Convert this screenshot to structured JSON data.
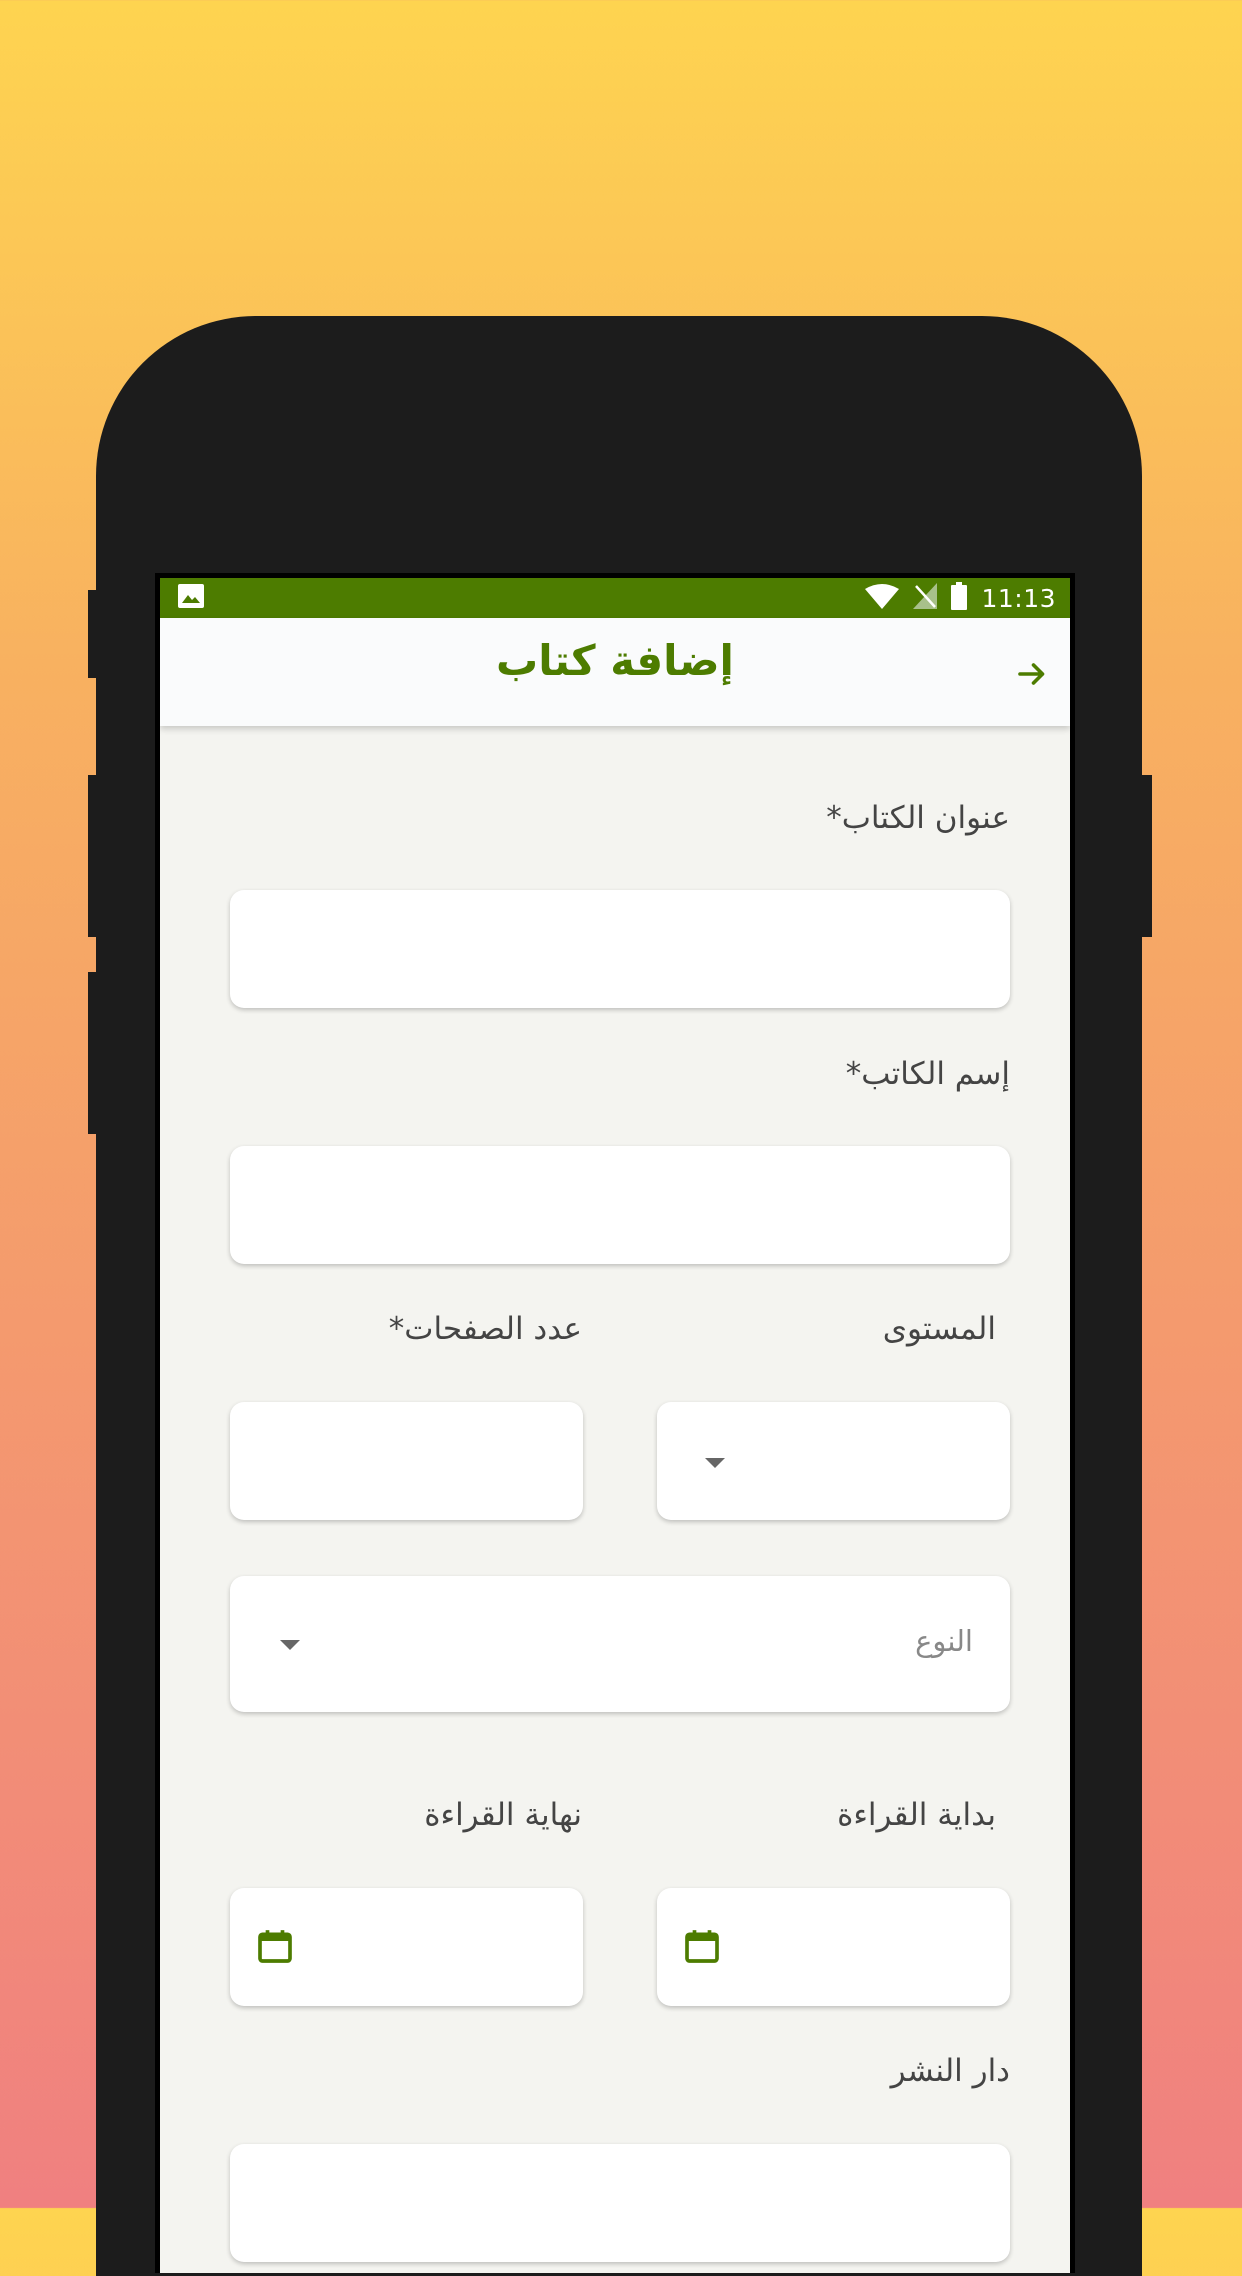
{
  "status_bar": {
    "time": "11:13",
    "icons": [
      "image-icon",
      "wifi-icon",
      "no-signal-icon",
      "battery-icon"
    ],
    "color": "#4d7c00"
  },
  "app_bar": {
    "title": "إضافة كتاب",
    "back_icon": "arrow-right-icon",
    "accent_color": "#4d7c00"
  },
  "form": {
    "book_title_label": "عنوان الكتاب*",
    "book_title_value": "",
    "author_label": "إسم الكاتب*",
    "author_value": "",
    "level_label": "المستوى",
    "level_value": "",
    "pages_label": "عدد الصفحات*",
    "pages_value": "",
    "genre_placeholder": "النوع",
    "reading_start_label": "بداية القراءة",
    "reading_start_value": "",
    "reading_end_label": "نهاية القراءة",
    "reading_end_value": "",
    "publisher_label": "دار النشر",
    "publisher_value": ""
  }
}
